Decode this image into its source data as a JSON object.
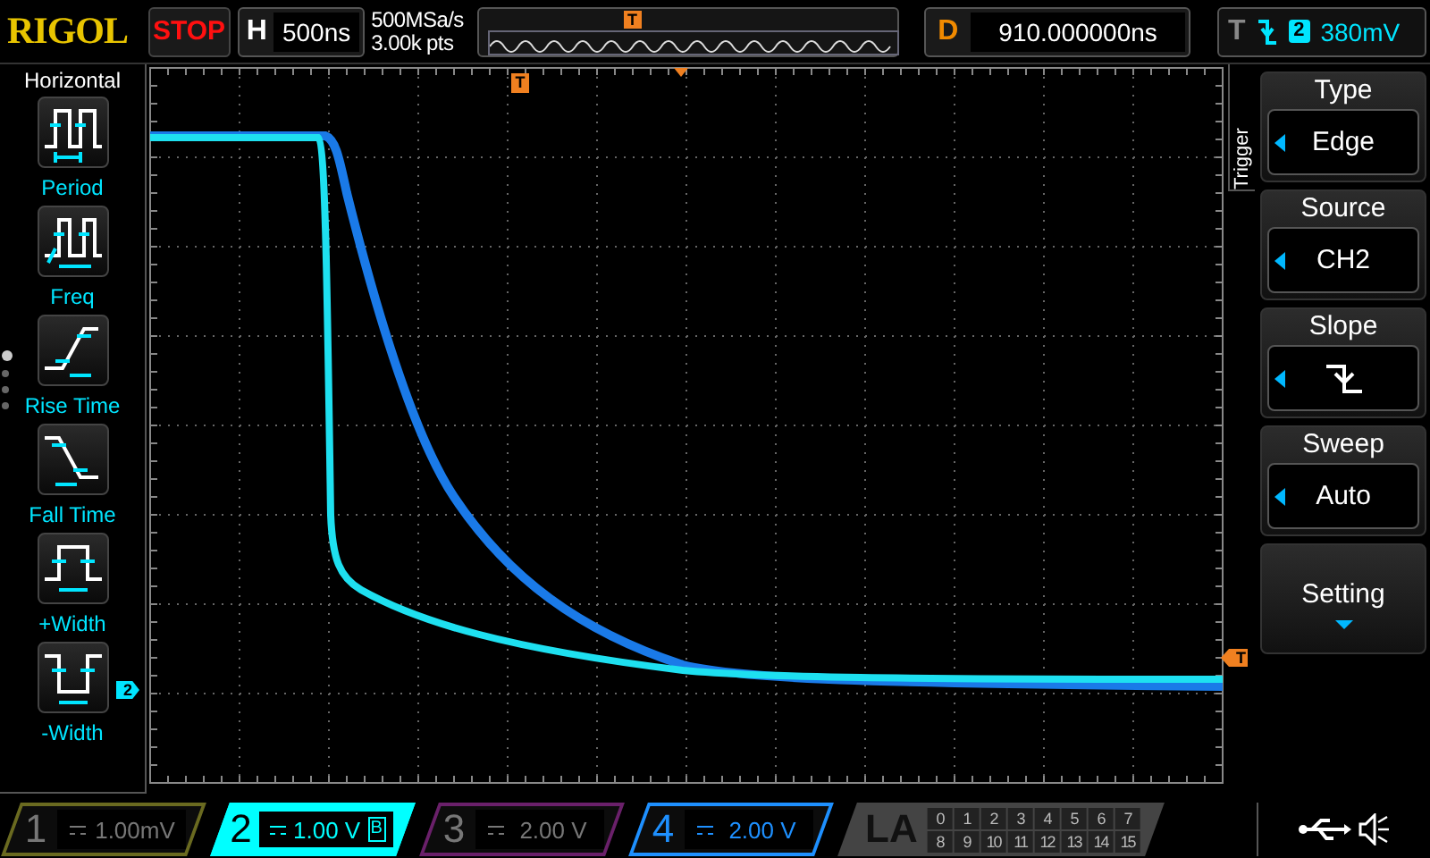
{
  "brand": "RIGOL",
  "run_state": "STOP",
  "timebase": {
    "label": "H",
    "value": "500ns"
  },
  "sample_rate": "500MSa/s",
  "memory_depth": "3.00k pts",
  "memory_strip": {
    "trigger_marker": "T"
  },
  "delay": {
    "label": "D",
    "value": "910.000000ns"
  },
  "trigger_status": {
    "label": "T",
    "source": "2",
    "level": "380mV"
  },
  "left_menu": {
    "title": "Horizontal",
    "items": [
      {
        "label": "Period",
        "kind": "period"
      },
      {
        "label": "Freq",
        "kind": "freq"
      },
      {
        "label": "Rise Time",
        "kind": "rise"
      },
      {
        "label": "Fall Time",
        "kind": "fall"
      },
      {
        "label": "+Width",
        "kind": "pwidth"
      },
      {
        "label": "-Width",
        "kind": "nwidth"
      }
    ],
    "pages": [
      {
        "selected": true
      },
      {
        "selected": false
      },
      {
        "selected": false
      },
      {
        "selected": false
      }
    ]
  },
  "screen": {
    "trigger_position_marker": "T",
    "channel_marker": "2",
    "trigger_level_marker": "T"
  },
  "trigger_menu": {
    "title": "Trigger",
    "items": [
      {
        "label": "Type",
        "value": "Edge",
        "kind": "value"
      },
      {
        "label": "Source",
        "value": "CH2",
        "kind": "value"
      },
      {
        "label": "Slope",
        "kind": "slope"
      },
      {
        "label": "Sweep",
        "value": "Auto",
        "kind": "value"
      },
      {
        "label": "Setting",
        "kind": "submenu"
      }
    ]
  },
  "channels": [
    {
      "number": "1",
      "scale": "1.00mV",
      "on": false,
      "selected": false,
      "color": "#6a6a20"
    },
    {
      "number": "2",
      "scale": "1.00 V",
      "on": true,
      "selected": true,
      "color": "#00ffff",
      "flag": "B"
    },
    {
      "number": "3",
      "scale": "2.00 V",
      "on": false,
      "selected": false,
      "color": "#6a206a"
    },
    {
      "number": "4",
      "scale": "2.00 V",
      "on": true,
      "selected": false,
      "color": "#1e90ff"
    }
  ],
  "la": {
    "label": "LA",
    "bits": [
      "0",
      "1",
      "2",
      "3",
      "4",
      "5",
      "6",
      "7",
      "8",
      "9",
      "10",
      "11",
      "12",
      "13",
      "14",
      "15"
    ]
  }
}
